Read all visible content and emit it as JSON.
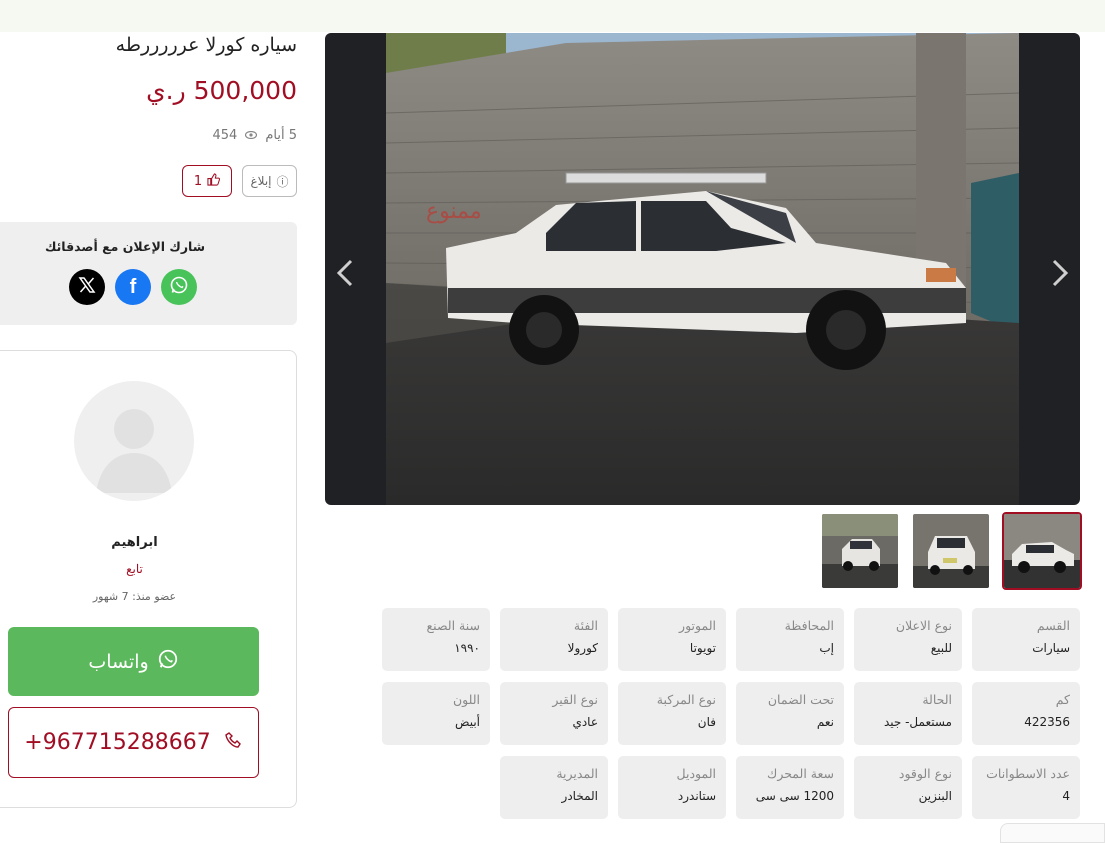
{
  "listing": {
    "title": "سياره كورلا عرررررطه",
    "price": "500,000 ر.ي",
    "posted": "5 أيام",
    "views": "454",
    "report_label": "إبلاغ",
    "likes": "1"
  },
  "share": {
    "title": "شارك الإعلان مع أصدقائك",
    "networks": [
      "x-icon",
      "facebook-icon",
      "whatsapp-icon"
    ]
  },
  "seller": {
    "name": "ابراهيم",
    "role": "تابع",
    "member_since": "عضو منذ: 7 شهور",
    "whatsapp_label": "واتساب",
    "phone": "+967715288667"
  },
  "gallery": {
    "thumbnail_count": 3,
    "active_index": 0
  },
  "specs": [
    {
      "label": "القسم",
      "value": "سيارات"
    },
    {
      "label": "نوع الاعلان",
      "value": "للبيع"
    },
    {
      "label": "المحافظة",
      "value": "إب"
    },
    {
      "label": "الموتور",
      "value": "تويوتا"
    },
    {
      "label": "الفئة",
      "value": "كورولا"
    },
    {
      "label": "سنة الصنع",
      "value": "١٩٩٠"
    },
    {
      "label": "كم",
      "value": "422356"
    },
    {
      "label": "الحالة",
      "value": "مستعمل- جيد"
    },
    {
      "label": "تحت الضمان",
      "value": "نعم"
    },
    {
      "label": "نوع المركبة",
      "value": "فان"
    },
    {
      "label": "نوع القير",
      "value": "عادي"
    },
    {
      "label": "اللون",
      "value": "أبيض"
    },
    {
      "label": "عدد الاسطوانات",
      "value": "4"
    },
    {
      "label": "نوع الوقود",
      "value": "البنزين"
    },
    {
      "label": "سعة المحرك",
      "value": "1200 سى سى"
    },
    {
      "label": "الموديل",
      "value": "ستاندرد"
    },
    {
      "label": "المديرية",
      "value": "المخادر"
    }
  ],
  "colors": {
    "accent": "#a10e24",
    "whatsapp": "#5cb85c",
    "facebook": "#1877f2",
    "x": "#000000"
  }
}
